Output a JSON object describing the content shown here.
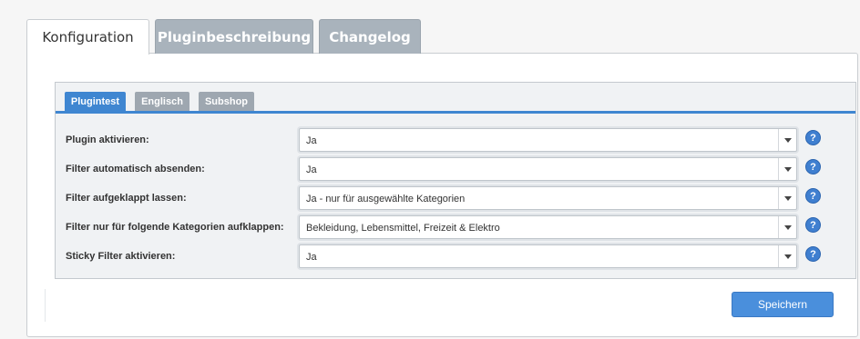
{
  "top_tabs": [
    {
      "label": "Konfiguration"
    },
    {
      "label": "Pluginbeschreibung"
    },
    {
      "label": "Changelog"
    }
  ],
  "sub_tabs": [
    {
      "label": "Plugintest"
    },
    {
      "label": "Englisch"
    },
    {
      "label": "Subshop"
    }
  ],
  "form": {
    "rows": [
      {
        "label": "Plugin aktivieren:",
        "value": "Ja"
      },
      {
        "label": "Filter automatisch absenden:",
        "value": "Ja"
      },
      {
        "label": "Filter aufgeklappt lassen:",
        "value": "Ja - nur für ausgewählte Kategorien"
      },
      {
        "label": "Filter nur für folgende Kategorien aufklappen:",
        "value": "Bekleidung, Lebensmittel, Freizeit & Elektro"
      },
      {
        "label": "Sticky Filter aktivieren:",
        "value": "Ja"
      }
    ],
    "help_symbol": "?"
  },
  "actions": {
    "save_label": "Speichern"
  },
  "colors": {
    "accent": "#3f86d1",
    "inactive_tab": "#a9b3bc",
    "button": "#4a8fdc"
  },
  "icons": {
    "help": "question-mark-icon",
    "dropdown": "chevron-down-icon"
  }
}
